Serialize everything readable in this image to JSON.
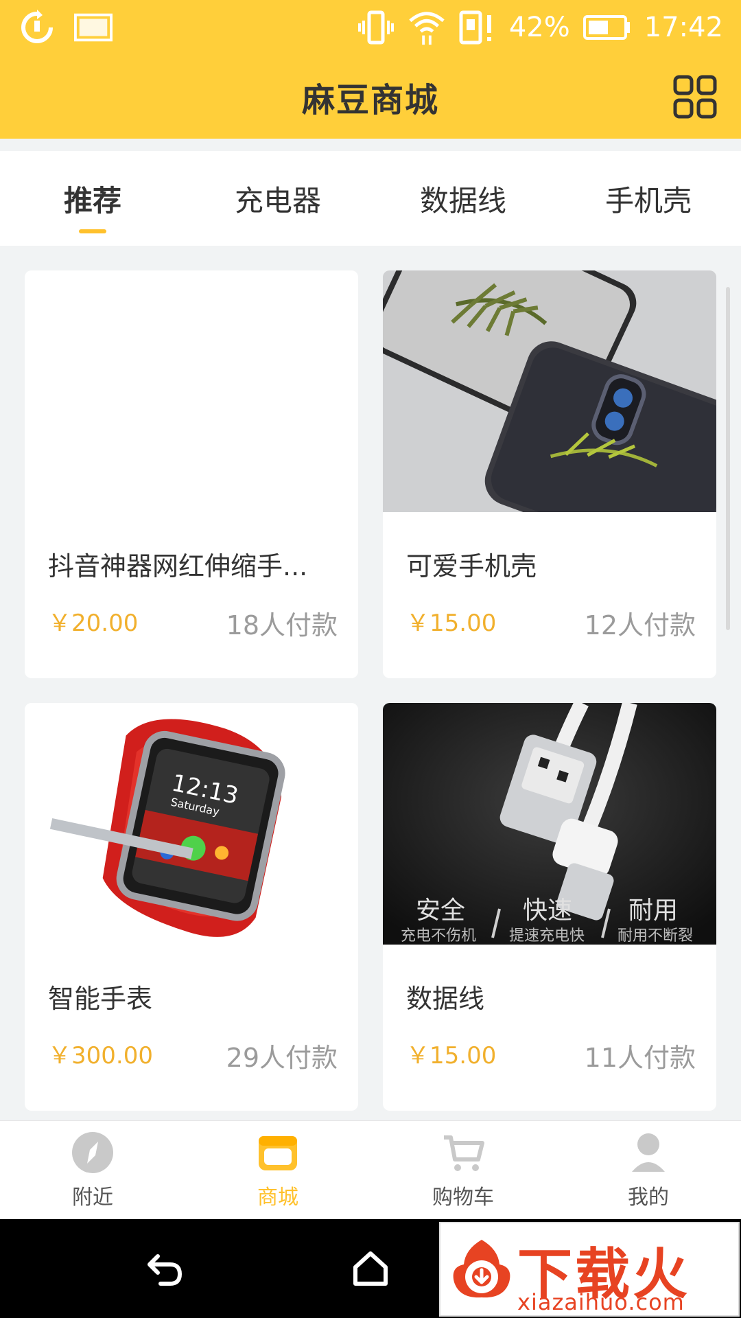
{
  "status_bar": {
    "battery_percent": "42%",
    "time": "17:42",
    "icons": [
      "sync-icon",
      "image-icon",
      "vibrate-icon",
      "wifi-icon",
      "sim-alert-icon",
      "battery-icon"
    ]
  },
  "header": {
    "title": "麻豆商城",
    "grid_icon": "grid-icon"
  },
  "tabs": [
    {
      "label": "推荐",
      "active": true
    },
    {
      "label": "充电器",
      "active": false
    },
    {
      "label": "数据线",
      "active": false
    },
    {
      "label": "手机壳",
      "active": false
    }
  ],
  "colors": {
    "brand_yellow": "#ffcf3a",
    "accent": "#ffc12c",
    "price": "#f1b02d",
    "muted": "#9b9b9b"
  },
  "products": [
    {
      "title": "抖音神器网红伸缩手...",
      "price": "￥20.00",
      "paid": "18人付款",
      "image": "blank-image"
    },
    {
      "title": "可爱手机壳",
      "price": "￥15.00",
      "paid": "12人付款",
      "image": "phone-case-image"
    },
    {
      "title": "智能手表",
      "price": "￥300.00",
      "paid": "29人付款",
      "image": "smart-watch-image"
    },
    {
      "title": "数据线",
      "price": "￥15.00",
      "paid": "11人付款",
      "image": "usb-cable-image"
    }
  ],
  "watch_image_text": {
    "time": "12:13",
    "day": "Saturday"
  },
  "cable_image_text": {
    "features": [
      "安全",
      "快速",
      "耐用"
    ],
    "subfeatures": [
      "充电不伤机",
      "提速充电快",
      "耐用不断裂"
    ]
  },
  "bottom_nav": [
    {
      "label": "附近",
      "icon": "compass-icon",
      "active": false
    },
    {
      "label": "商城",
      "icon": "store-icon",
      "active": true
    },
    {
      "label": "购物车",
      "icon": "cart-icon",
      "active": false
    },
    {
      "label": "我的",
      "icon": "user-icon",
      "active": false
    }
  ],
  "system_nav": [
    "back-icon",
    "home-icon",
    "recents-icon"
  ],
  "watermark": {
    "brand": "下载火",
    "url": "xiazaihuo.com"
  }
}
